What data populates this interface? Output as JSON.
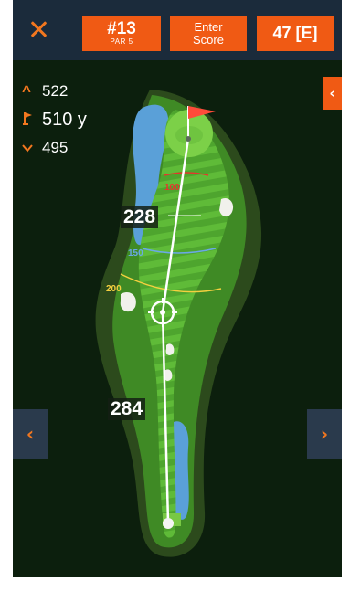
{
  "header": {
    "hole_number": "#13",
    "par_label": "PAR 5",
    "enter_score_line1": "Enter",
    "enter_score_line2": "Score",
    "total_score": "47 [E]"
  },
  "distances": {
    "back": "522",
    "middle": "510 y",
    "front": "495"
  },
  "map": {
    "shot_distance_to_pin": "228",
    "shot_distance_from_tee": "284",
    "arc_labels": [
      "100",
      "150",
      "200"
    ]
  },
  "icons": {
    "close": "close-icon",
    "back_distance": "chevron-up-icon",
    "middle_distance": "flag-icon",
    "front_distance": "chevron-down-icon",
    "collapse": "chevron-left-icon",
    "prev_hole": "chevron-left-icon",
    "next_hole": "chevron-right-icon",
    "target": "crosshair-icon"
  },
  "colors": {
    "accent": "#f05a14",
    "topbar": "#1b2b3b",
    "background": "#0c1f0d",
    "fairway": "#55b033",
    "water": "#5aa0d8",
    "arc_100": "#e8342d",
    "arc_150": "#6aa8e6",
    "arc_200": "#f4d03f"
  }
}
